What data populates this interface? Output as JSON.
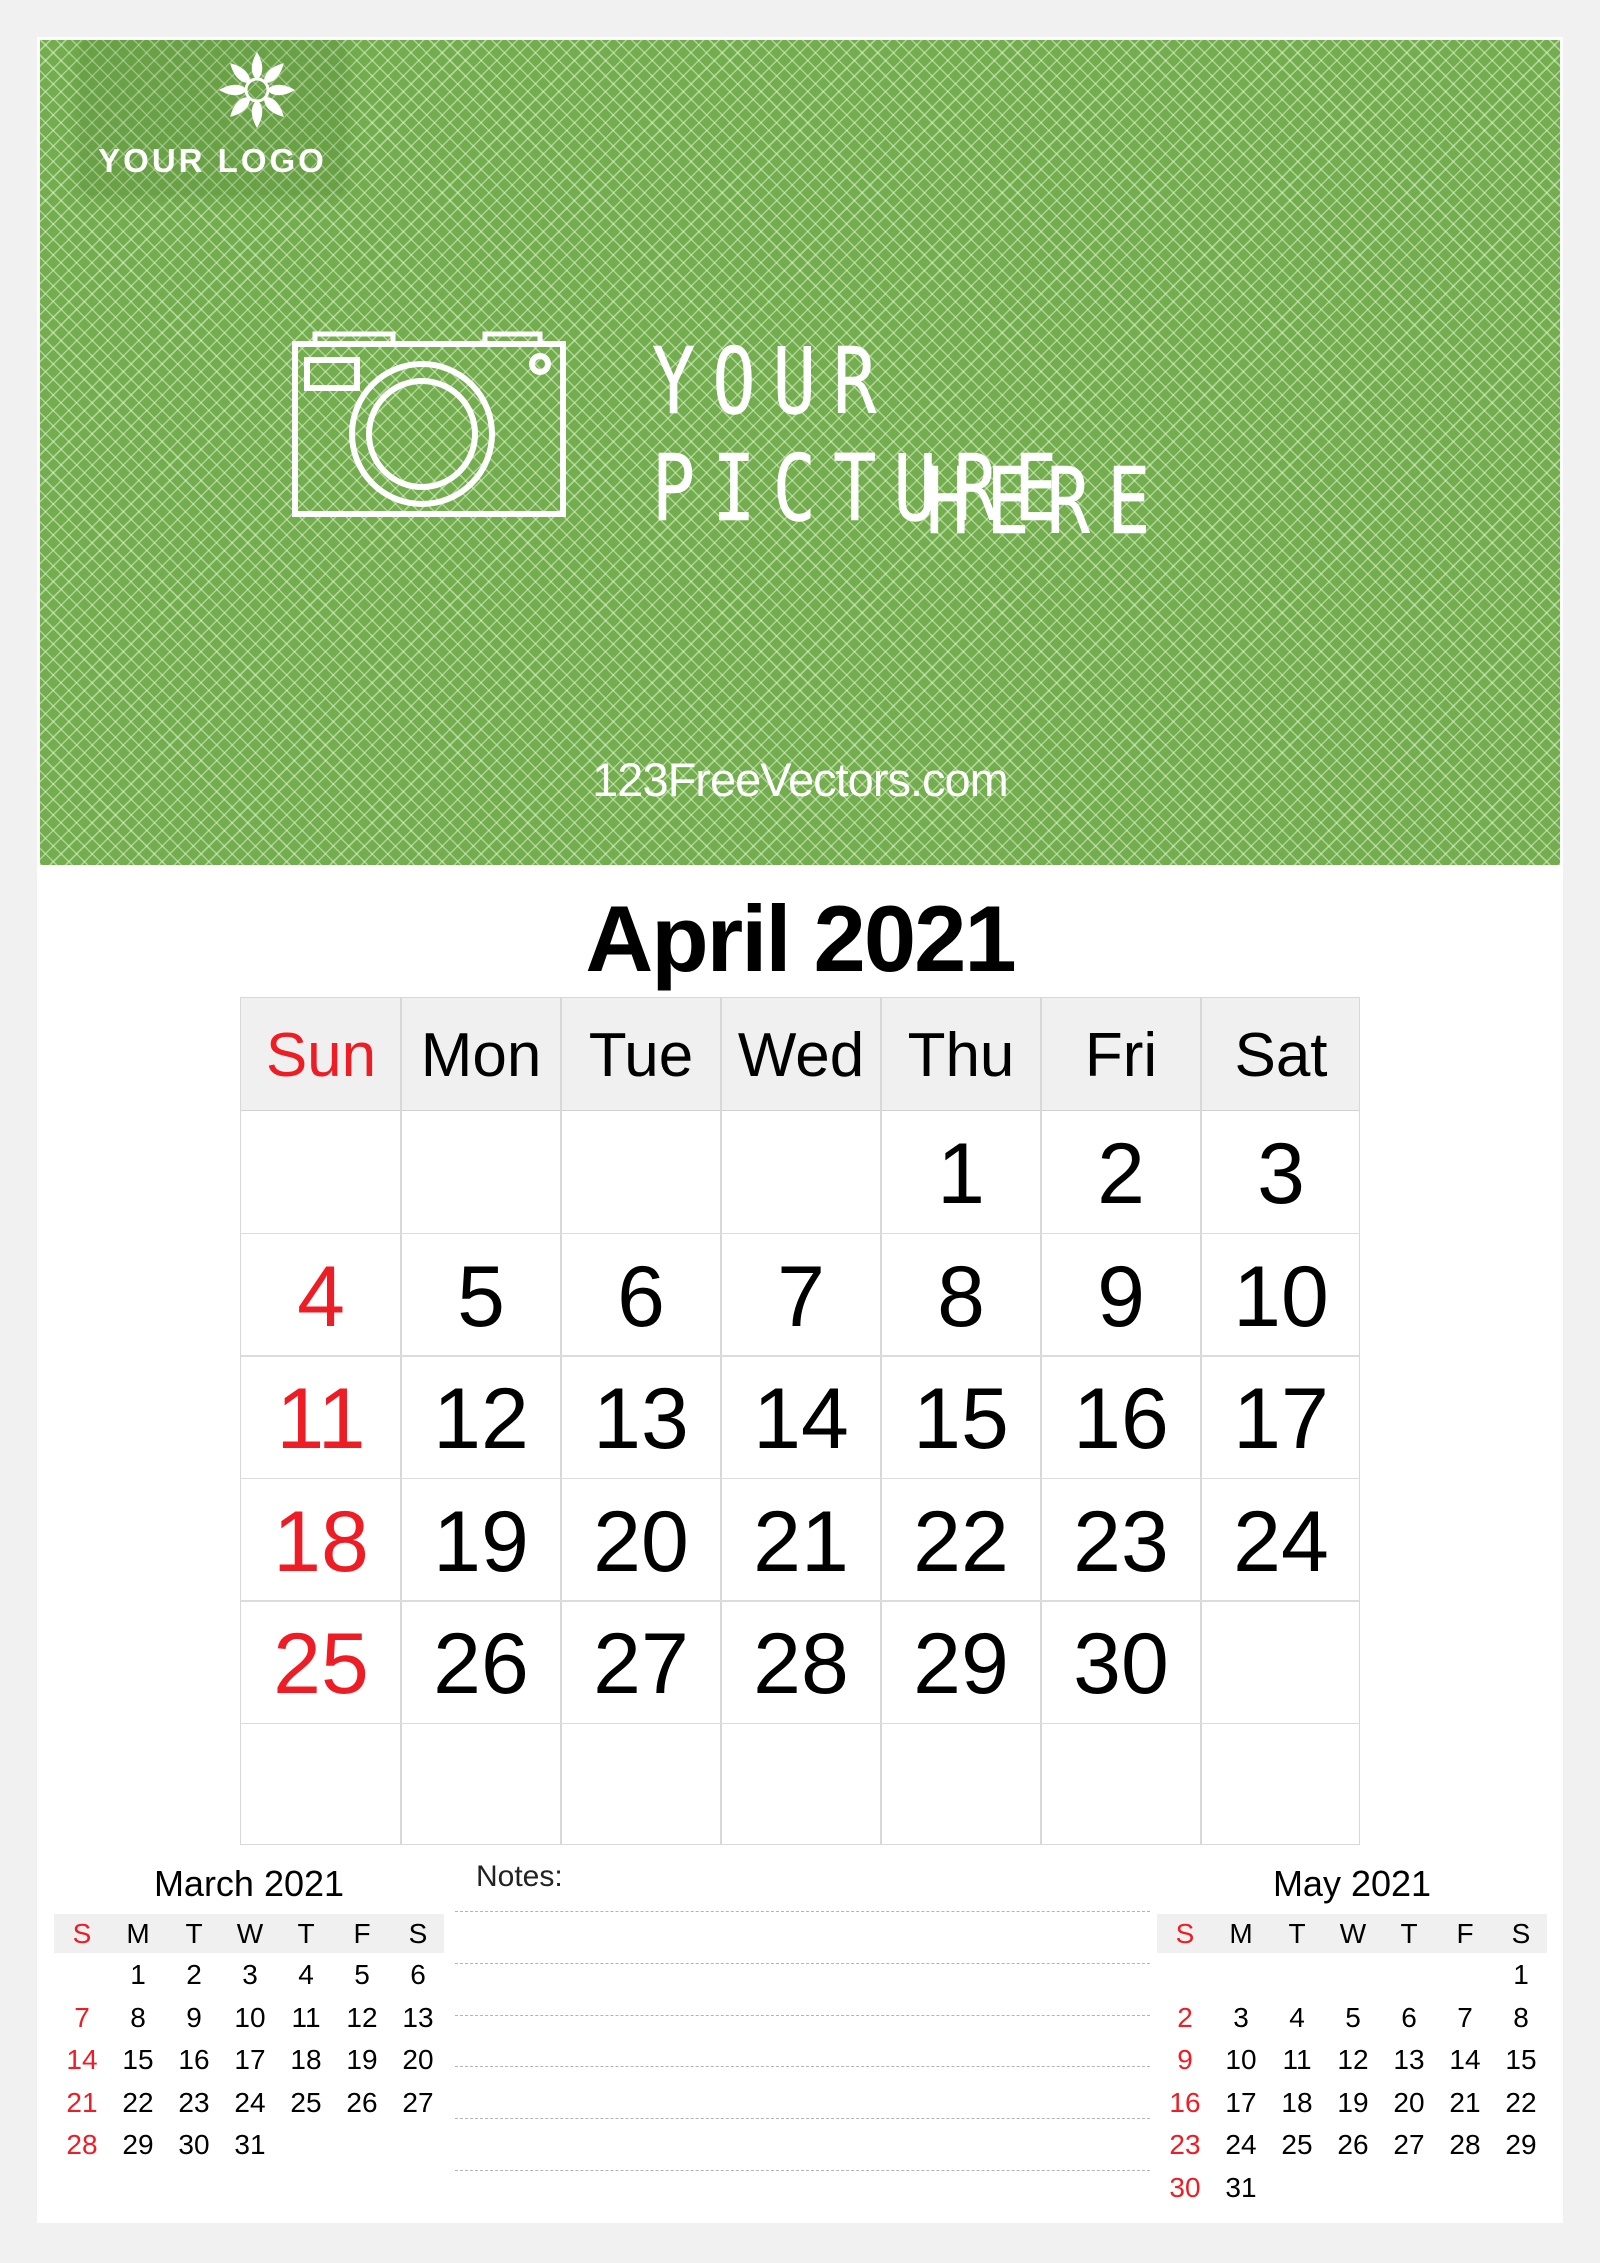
{
  "hero": {
    "logo_text": "YOUR LOGO",
    "picture_line1": "YOUR PICTURE",
    "picture_line2": "HERE",
    "website": "123FreeVectors.com",
    "colors": {
      "green": "#74ad4f",
      "text": "#ffffff"
    }
  },
  "calendar": {
    "title": "April 2021",
    "weekdays": [
      "Sun",
      "Mon",
      "Tue",
      "Wed",
      "Thu",
      "Fri",
      "Sat"
    ],
    "weeks": [
      [
        "",
        "",
        "",
        "",
        "1",
        "2",
        "3"
      ],
      [
        "4",
        "5",
        "6",
        "7",
        "8",
        "9",
        "10"
      ],
      [
        "11",
        "12",
        "13",
        "14",
        "15",
        "16",
        "17"
      ],
      [
        "18",
        "19",
        "20",
        "21",
        "22",
        "23",
        "24"
      ],
      [
        "25",
        "26",
        "27",
        "28",
        "29",
        "30",
        ""
      ],
      [
        "",
        "",
        "",
        "",
        "",
        "",
        ""
      ]
    ],
    "colors": {
      "sunday": "#ee1c24",
      "default": "#000000",
      "header_bg": "#f0f0f0"
    }
  },
  "prev_month": {
    "title": "March 2021",
    "weekdays": [
      "S",
      "M",
      "T",
      "W",
      "T",
      "F",
      "S"
    ],
    "weeks": [
      [
        "",
        "1",
        "2",
        "3",
        "4",
        "5",
        "6"
      ],
      [
        "7",
        "8",
        "9",
        "10",
        "11",
        "12",
        "13"
      ],
      [
        "14",
        "15",
        "16",
        "17",
        "18",
        "19",
        "20"
      ],
      [
        "21",
        "22",
        "23",
        "24",
        "25",
        "26",
        "27"
      ],
      [
        "28",
        "29",
        "30",
        "31",
        "",
        "",
        ""
      ]
    ]
  },
  "next_month": {
    "title": "May 2021",
    "weekdays": [
      "S",
      "M",
      "T",
      "W",
      "T",
      "F",
      "S"
    ],
    "weeks": [
      [
        "",
        "",
        "",
        "",
        "",
        "",
        "1"
      ],
      [
        "2",
        "3",
        "4",
        "5",
        "6",
        "7",
        "8"
      ],
      [
        "9",
        "10",
        "11",
        "12",
        "13",
        "14",
        "15"
      ],
      [
        "16",
        "17",
        "18",
        "19",
        "20",
        "21",
        "22"
      ],
      [
        "23",
        "24",
        "25",
        "26",
        "27",
        "28",
        "29"
      ],
      [
        "30",
        "31",
        "",
        "",
        "",
        "",
        ""
      ]
    ]
  },
  "notes": {
    "label": "Notes:",
    "line_count": 6
  }
}
